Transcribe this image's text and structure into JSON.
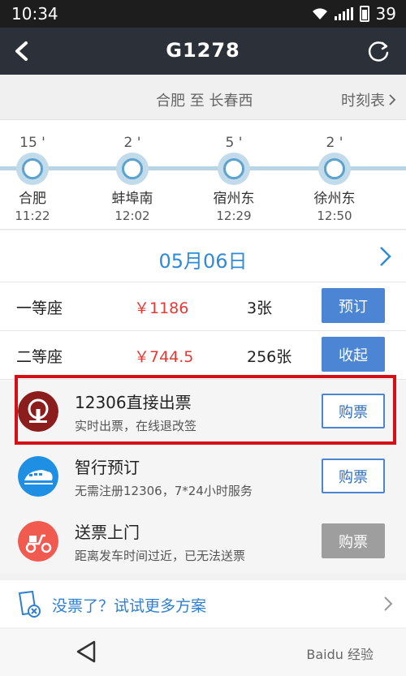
{
  "status_bar": {
    "time": "10:34",
    "battery": "39"
  },
  "header": {
    "title": "G1278"
  },
  "route": {
    "text": "合肥 至 长春西",
    "timetable_label": "时刻表"
  },
  "stops": [
    {
      "dwell": "15 '",
      "name": "合肥",
      "time": "11:22"
    },
    {
      "dwell": "2 '",
      "name": "蚌埠南",
      "time": "12:02"
    },
    {
      "dwell": "5 '",
      "name": "宿州东",
      "time": "12:29"
    },
    {
      "dwell": "2 '",
      "name": "徐州东",
      "time": "12:50"
    }
  ],
  "date": {
    "text": "05月06日"
  },
  "seats": [
    {
      "name": "一等座",
      "price": "￥1186",
      "count": "3张",
      "button": "预订"
    },
    {
      "name": "二等座",
      "price": "￥744.5",
      "count": "256张",
      "button": "收起"
    }
  ],
  "options": [
    {
      "title": "12306直接出票",
      "subtitle": "实时出票，在线退改签",
      "button": "购票",
      "icon": "railway-logo-icon"
    },
    {
      "title": "智行预订",
      "subtitle": "无需注册12306，7*24小时服务",
      "button": "购票",
      "icon": "train-icon"
    },
    {
      "title": "送票上门",
      "subtitle": "距离发车时间过近，已无法送票",
      "button": "购票",
      "icon": "scooter-icon"
    }
  ],
  "more": {
    "text": "没票了？试试更多方案"
  },
  "watermark": {
    "text": "Baidu 经验"
  },
  "colors": {
    "accent": "#4b85d3",
    "price": "#e53935",
    "header": "#2c3139",
    "highlight": "#d60f17"
  }
}
